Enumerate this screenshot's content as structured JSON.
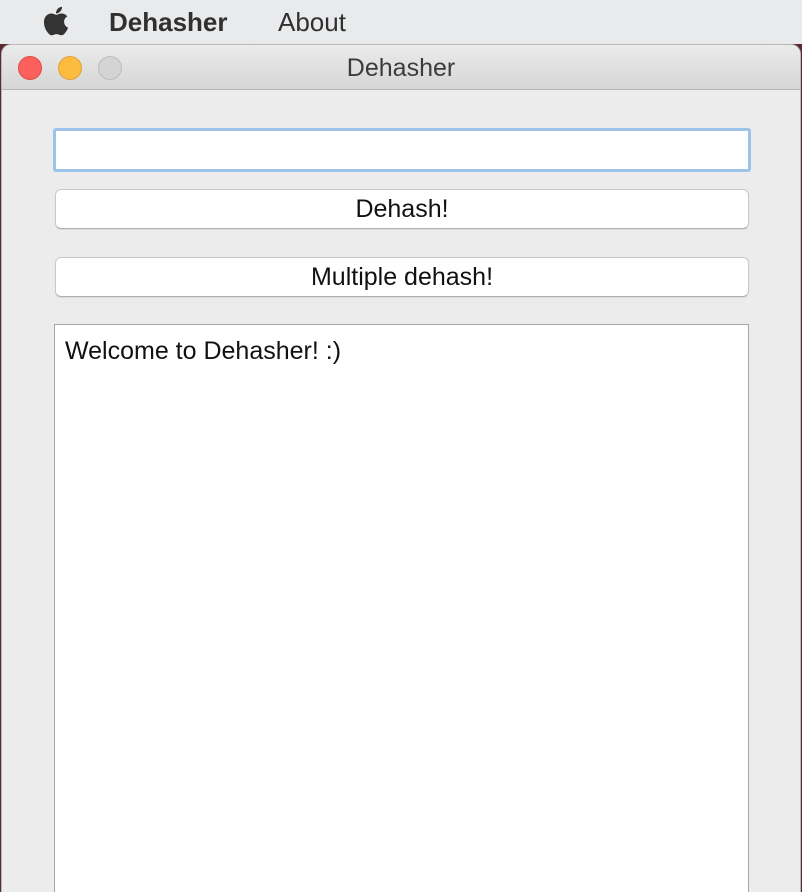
{
  "menubar": {
    "apple_icon": "apple-icon",
    "app_name": "Dehasher",
    "about_label": "About"
  },
  "window": {
    "title": "Dehasher",
    "controls": {
      "close_color": "#fc605c",
      "minimize_color": "#fdbc40",
      "zoom_color": "#d4d4d4"
    }
  },
  "form": {
    "hash_input_value": "",
    "dehash_label": "Dehash!",
    "multiple_dehash_label": "Multiple dehash!"
  },
  "output": {
    "text": "Welcome to Dehasher! :)"
  },
  "colors": {
    "focus_ring": "#9ec3ea"
  }
}
